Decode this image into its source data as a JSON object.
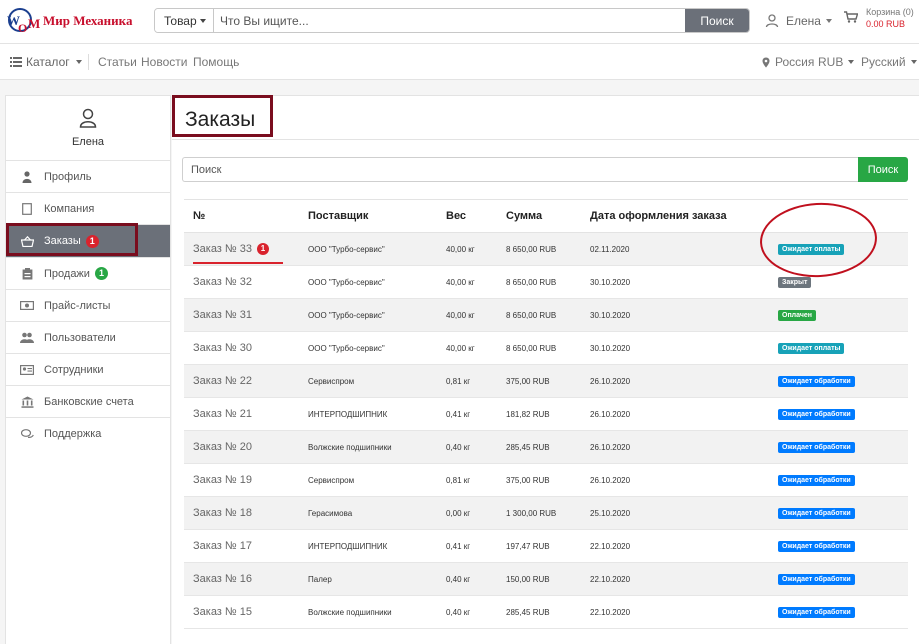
{
  "header": {
    "logo_text": "Мир Механика",
    "logo_mark": "WOM",
    "search_type": "Товар",
    "search_placeholder": "Что Вы ищите...",
    "search_button": "Поиск",
    "user_name": "Елена",
    "cart_label": "Корзина (0)",
    "cart_total": "0.00 RUB"
  },
  "nav": {
    "catalog": "Каталог",
    "links": [
      "Статьи",
      "Новости",
      "Помощь"
    ],
    "region": "Россия",
    "currency": "RUB",
    "language": "Русский"
  },
  "sidebar": {
    "user_name": "Елена",
    "items": [
      {
        "label": "Профиль",
        "icon": "person-icon"
      },
      {
        "label": "Компания",
        "icon": "document-icon"
      },
      {
        "label": "Заказы",
        "icon": "basket-icon",
        "badge": "1",
        "active": true
      },
      {
        "label": "Продажи",
        "icon": "clipboard-icon",
        "badge": "1"
      },
      {
        "label": "Прайс-листы",
        "icon": "banknote-icon"
      },
      {
        "label": "Пользователи",
        "icon": "users-icon"
      },
      {
        "label": "Сотрудники",
        "icon": "id-card-icon"
      },
      {
        "label": "Банковские счета",
        "icon": "bank-icon"
      },
      {
        "label": "Поддержка",
        "icon": "chat-icon"
      }
    ]
  },
  "main": {
    "title": "Заказы",
    "search_placeholder": "Поиск",
    "search_button": "Поиск",
    "columns": [
      "№",
      "Поставщик",
      "Вес",
      "Сумма",
      "Дата оформления заказа",
      ""
    ],
    "orders": [
      {
        "id": "Заказ № 33",
        "badge": "1",
        "supplier": "ООО \"Турбо-сервис\"",
        "weight": "40,00 кг",
        "sum": "8 650,00 RUB",
        "date": "02.11.2020",
        "status": "Ожидает оплаты"
      },
      {
        "id": "Заказ № 32",
        "supplier": "ООО \"Турбо-сервис\"",
        "weight": "40,00 кг",
        "sum": "8 650,00 RUB",
        "date": "30.10.2020",
        "status": "Закрыт"
      },
      {
        "id": "Заказ № 31",
        "supplier": "ООО \"Турбо-сервис\"",
        "weight": "40,00 кг",
        "sum": "8 650,00 RUB",
        "date": "30.10.2020",
        "status": "Оплачен"
      },
      {
        "id": "Заказ № 30",
        "supplier": "ООО \"Турбо-сервис\"",
        "weight": "40,00 кг",
        "sum": "8 650,00 RUB",
        "date": "30.10.2020",
        "status": "Ожидает оплаты"
      },
      {
        "id": "Заказ № 22",
        "supplier": "Сервиспром",
        "weight": "0,81 кг",
        "sum": "375,00 RUB",
        "date": "26.10.2020",
        "status": "Ожидает обработки"
      },
      {
        "id": "Заказ № 21",
        "supplier": "ИНТЕРПОДШИПНИК",
        "weight": "0,41 кг",
        "sum": "181,82 RUB",
        "date": "26.10.2020",
        "status": "Ожидает обработки"
      },
      {
        "id": "Заказ № 20",
        "supplier": "Волжские подшипники",
        "weight": "0,40 кг",
        "sum": "285,45 RUB",
        "date": "26.10.2020",
        "status": "Ожидает обработки"
      },
      {
        "id": "Заказ № 19",
        "supplier": "Сервиспром",
        "weight": "0,81 кг",
        "sum": "375,00 RUB",
        "date": "26.10.2020",
        "status": "Ожидает обработки"
      },
      {
        "id": "Заказ № 18",
        "supplier": "Герасимова",
        "weight": "0,00 кг",
        "sum": "1 300,00 RUB",
        "date": "25.10.2020",
        "status": "Ожидает обработки"
      },
      {
        "id": "Заказ № 17",
        "supplier": "ИНТЕРПОДШИПНИК",
        "weight": "0,41 кг",
        "sum": "197,47 RUB",
        "date": "22.10.2020",
        "status": "Ожидает обработки"
      },
      {
        "id": "Заказ № 16",
        "supplier": "Палер",
        "weight": "0,40 кг",
        "sum": "150,00 RUB",
        "date": "22.10.2020",
        "status": "Ожидает обработки"
      },
      {
        "id": "Заказ № 15",
        "supplier": "Волжские подшипники",
        "weight": "0,40 кг",
        "sum": "285,45 RUB",
        "date": "22.10.2020",
        "status": "Ожидает обработки"
      }
    ]
  },
  "status_colors": {
    "Ожидает оплаты": "#17a2b8",
    "Закрыт": "#6c757d",
    "Оплачен": "#28a745",
    "Ожидает обработки": "#007bff"
  },
  "colors": {
    "brand_red": "#c8102e",
    "active_gray": "#6b7079",
    "success_green": "#28a745",
    "annotation_maroon": "#7a0d1e"
  }
}
